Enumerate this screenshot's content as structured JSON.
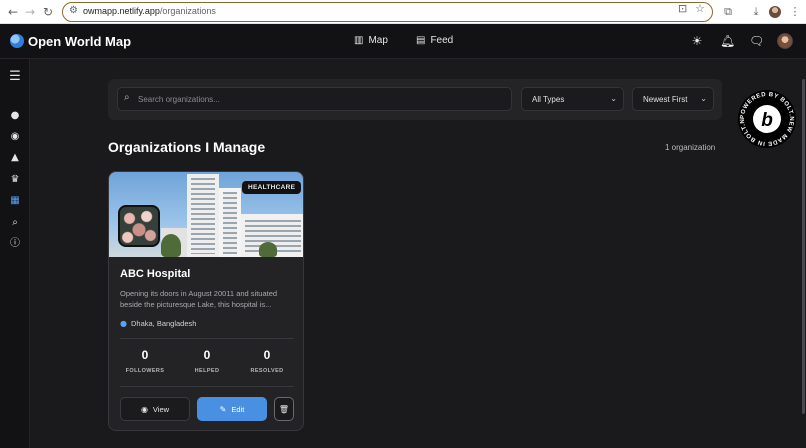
{
  "browser": {
    "url_host": "owmapp.netlify.app",
    "url_path": "/organizations"
  },
  "header": {
    "app_title": "Open World Map",
    "nav": [
      {
        "label": "Map",
        "icon": "map-icon"
      },
      {
        "label": "Feed",
        "icon": "newspaper-icon"
      }
    ],
    "icons": [
      "sun-icon",
      "bell-icon",
      "messages-icon",
      "user-avatar"
    ]
  },
  "sidebar": {
    "items": [
      {
        "icon": "menu-icon"
      },
      {
        "icon": "user-icon"
      },
      {
        "icon": "compass-icon"
      },
      {
        "icon": "alert-icon"
      },
      {
        "icon": "trophy-icon"
      },
      {
        "icon": "organization-icon",
        "active": true
      },
      {
        "icon": "search-icon"
      },
      {
        "icon": "info-icon"
      }
    ]
  },
  "filters": {
    "search_placeholder": "Search organizations...",
    "type_select": "All Types",
    "sort_select": "Newest First"
  },
  "section": {
    "title": "Organizations I Manage",
    "count": "1 organization"
  },
  "organizations": [
    {
      "badge": "HEALTHCARE",
      "name": "ABC Hospital",
      "description": "Opening its doors in August 20011 and situated beside the picturesque Lake, this hospital is...",
      "location": "Dhaka, Bangladesh",
      "stats": [
        {
          "value": "0",
          "label": "FOLLOWERS"
        },
        {
          "value": "0",
          "label": "HELPED"
        },
        {
          "value": "0",
          "label": "RESOLVED"
        }
      ],
      "actions": {
        "view": "View",
        "edit": "Edit"
      }
    }
  ],
  "bolt_badge": {
    "text": "POWERED BY BOLT.NEW MADE IN BOLT.NEW",
    "glyph": "b"
  },
  "colors": {
    "accent": "#4a90e2",
    "background": "#1a1a1c",
    "header": "#121214",
    "card": "#232326"
  }
}
